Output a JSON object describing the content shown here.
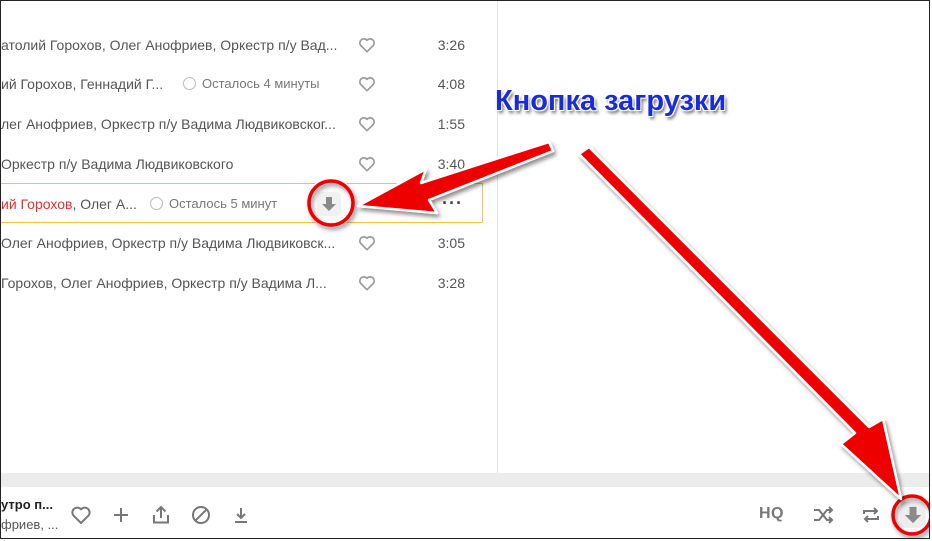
{
  "tracks": [
    {
      "artists": "атолий Горохов, Олег Анофриев, Оркестр п/у Вад...",
      "duration": "3:26"
    },
    {
      "artists": "ий Горохов, Геннадий Г...",
      "remaining": "Осталось 4 минуты",
      "duration": "4:08"
    },
    {
      "artists": "лег Анофриев, Оркестр п/у Вадима Людвиковског...",
      "duration": "1:55"
    },
    {
      "artists": "Оркестр п/у Вадима Людвиковского",
      "duration": "3:40"
    },
    {
      "artists_highlight": "ий Горохов",
      "artists_rest": ", Олег А...",
      "remaining": "Осталось 5 минут"
    },
    {
      "artists": "Олег Анофриев, Оркестр п/у Вадима Людвиковск...",
      "duration": "3:05"
    },
    {
      "artists": "Горохов, Олег Анофриев, Оркестр п/у Вадима Л...",
      "duration": "3:28"
    }
  ],
  "player": {
    "title": "утро п...",
    "artist": "фриев, ...",
    "hq_label": "HQ"
  },
  "annotation": {
    "label": "Кнопка загрузки",
    "color": "#1b2bd6",
    "arrow_color": "#ee0000"
  },
  "colors": {
    "highlight_artist": "#e03030",
    "active_row_border": "#f6c343"
  },
  "icons": {
    "like": "heart-icon",
    "download": "download-icon",
    "more": "more-dots-icon",
    "add": "plus-icon",
    "share": "share-icon",
    "block": "block-icon",
    "shuffle": "shuffle-icon",
    "repeat": "repeat-icon"
  }
}
